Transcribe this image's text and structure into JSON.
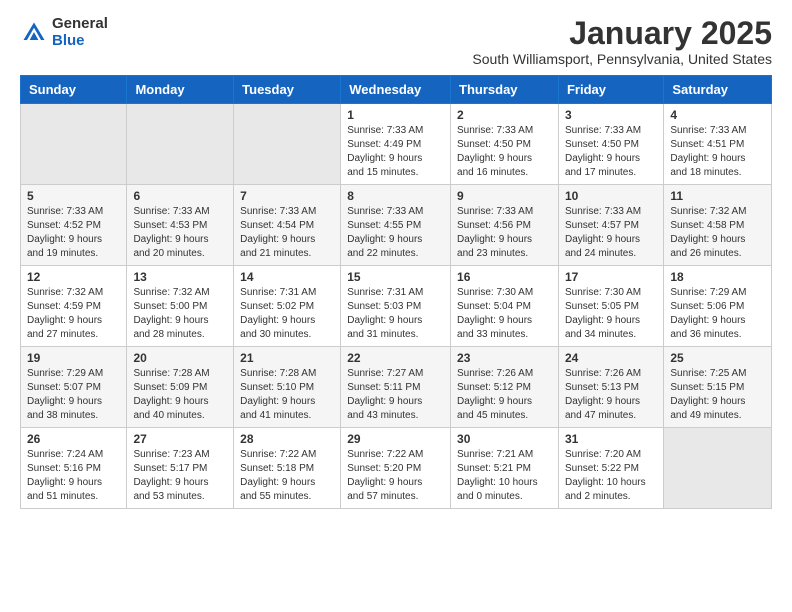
{
  "logo": {
    "general": "General",
    "blue": "Blue"
  },
  "title": "January 2025",
  "location": "South Williamsport, Pennsylvania, United States",
  "headers": [
    "Sunday",
    "Monday",
    "Tuesday",
    "Wednesday",
    "Thursday",
    "Friday",
    "Saturday"
  ],
  "weeks": [
    [
      {
        "day": "",
        "info": ""
      },
      {
        "day": "",
        "info": ""
      },
      {
        "day": "",
        "info": ""
      },
      {
        "day": "1",
        "info": "Sunrise: 7:33 AM\nSunset: 4:49 PM\nDaylight: 9 hours\nand 15 minutes."
      },
      {
        "day": "2",
        "info": "Sunrise: 7:33 AM\nSunset: 4:50 PM\nDaylight: 9 hours\nand 16 minutes."
      },
      {
        "day": "3",
        "info": "Sunrise: 7:33 AM\nSunset: 4:50 PM\nDaylight: 9 hours\nand 17 minutes."
      },
      {
        "day": "4",
        "info": "Sunrise: 7:33 AM\nSunset: 4:51 PM\nDaylight: 9 hours\nand 18 minutes."
      }
    ],
    [
      {
        "day": "5",
        "info": "Sunrise: 7:33 AM\nSunset: 4:52 PM\nDaylight: 9 hours\nand 19 minutes."
      },
      {
        "day": "6",
        "info": "Sunrise: 7:33 AM\nSunset: 4:53 PM\nDaylight: 9 hours\nand 20 minutes."
      },
      {
        "day": "7",
        "info": "Sunrise: 7:33 AM\nSunset: 4:54 PM\nDaylight: 9 hours\nand 21 minutes."
      },
      {
        "day": "8",
        "info": "Sunrise: 7:33 AM\nSunset: 4:55 PM\nDaylight: 9 hours\nand 22 minutes."
      },
      {
        "day": "9",
        "info": "Sunrise: 7:33 AM\nSunset: 4:56 PM\nDaylight: 9 hours\nand 23 minutes."
      },
      {
        "day": "10",
        "info": "Sunrise: 7:33 AM\nSunset: 4:57 PM\nDaylight: 9 hours\nand 24 minutes."
      },
      {
        "day": "11",
        "info": "Sunrise: 7:32 AM\nSunset: 4:58 PM\nDaylight: 9 hours\nand 26 minutes."
      }
    ],
    [
      {
        "day": "12",
        "info": "Sunrise: 7:32 AM\nSunset: 4:59 PM\nDaylight: 9 hours\nand 27 minutes."
      },
      {
        "day": "13",
        "info": "Sunrise: 7:32 AM\nSunset: 5:00 PM\nDaylight: 9 hours\nand 28 minutes."
      },
      {
        "day": "14",
        "info": "Sunrise: 7:31 AM\nSunset: 5:02 PM\nDaylight: 9 hours\nand 30 minutes."
      },
      {
        "day": "15",
        "info": "Sunrise: 7:31 AM\nSunset: 5:03 PM\nDaylight: 9 hours\nand 31 minutes."
      },
      {
        "day": "16",
        "info": "Sunrise: 7:30 AM\nSunset: 5:04 PM\nDaylight: 9 hours\nand 33 minutes."
      },
      {
        "day": "17",
        "info": "Sunrise: 7:30 AM\nSunset: 5:05 PM\nDaylight: 9 hours\nand 34 minutes."
      },
      {
        "day": "18",
        "info": "Sunrise: 7:29 AM\nSunset: 5:06 PM\nDaylight: 9 hours\nand 36 minutes."
      }
    ],
    [
      {
        "day": "19",
        "info": "Sunrise: 7:29 AM\nSunset: 5:07 PM\nDaylight: 9 hours\nand 38 minutes."
      },
      {
        "day": "20",
        "info": "Sunrise: 7:28 AM\nSunset: 5:09 PM\nDaylight: 9 hours\nand 40 minutes."
      },
      {
        "day": "21",
        "info": "Sunrise: 7:28 AM\nSunset: 5:10 PM\nDaylight: 9 hours\nand 41 minutes."
      },
      {
        "day": "22",
        "info": "Sunrise: 7:27 AM\nSunset: 5:11 PM\nDaylight: 9 hours\nand 43 minutes."
      },
      {
        "day": "23",
        "info": "Sunrise: 7:26 AM\nSunset: 5:12 PM\nDaylight: 9 hours\nand 45 minutes."
      },
      {
        "day": "24",
        "info": "Sunrise: 7:26 AM\nSunset: 5:13 PM\nDaylight: 9 hours\nand 47 minutes."
      },
      {
        "day": "25",
        "info": "Sunrise: 7:25 AM\nSunset: 5:15 PM\nDaylight: 9 hours\nand 49 minutes."
      }
    ],
    [
      {
        "day": "26",
        "info": "Sunrise: 7:24 AM\nSunset: 5:16 PM\nDaylight: 9 hours\nand 51 minutes."
      },
      {
        "day": "27",
        "info": "Sunrise: 7:23 AM\nSunset: 5:17 PM\nDaylight: 9 hours\nand 53 minutes."
      },
      {
        "day": "28",
        "info": "Sunrise: 7:22 AM\nSunset: 5:18 PM\nDaylight: 9 hours\nand 55 minutes."
      },
      {
        "day": "29",
        "info": "Sunrise: 7:22 AM\nSunset: 5:20 PM\nDaylight: 9 hours\nand 57 minutes."
      },
      {
        "day": "30",
        "info": "Sunrise: 7:21 AM\nSunset: 5:21 PM\nDaylight: 10 hours\nand 0 minutes."
      },
      {
        "day": "31",
        "info": "Sunrise: 7:20 AM\nSunset: 5:22 PM\nDaylight: 10 hours\nand 2 minutes."
      },
      {
        "day": "",
        "info": ""
      }
    ]
  ]
}
